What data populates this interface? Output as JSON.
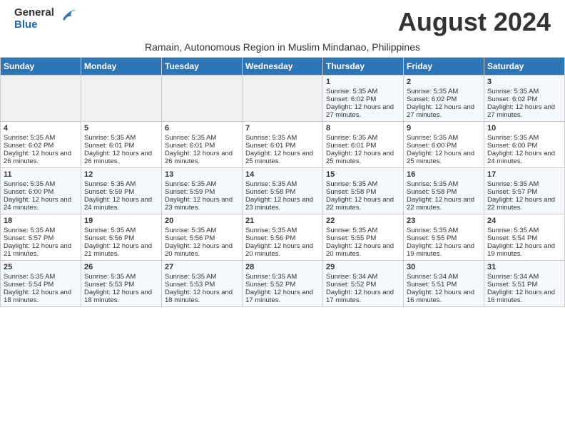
{
  "header": {
    "logo_general": "General",
    "logo_blue": "Blue",
    "month_title": "August 2024",
    "subtitle": "Ramain, Autonomous Region in Muslim Mindanao, Philippines"
  },
  "weekdays": [
    "Sunday",
    "Monday",
    "Tuesday",
    "Wednesday",
    "Thursday",
    "Friday",
    "Saturday"
  ],
  "weeks": [
    [
      {
        "day": "",
        "sunrise": "",
        "sunset": "",
        "daylight": "",
        "empty": true
      },
      {
        "day": "",
        "sunrise": "",
        "sunset": "",
        "daylight": "",
        "empty": true
      },
      {
        "day": "",
        "sunrise": "",
        "sunset": "",
        "daylight": "",
        "empty": true
      },
      {
        "day": "",
        "sunrise": "",
        "sunset": "",
        "daylight": "",
        "empty": true
      },
      {
        "day": "1",
        "sunrise": "Sunrise: 5:35 AM",
        "sunset": "Sunset: 6:02 PM",
        "daylight": "Daylight: 12 hours and 27 minutes."
      },
      {
        "day": "2",
        "sunrise": "Sunrise: 5:35 AM",
        "sunset": "Sunset: 6:02 PM",
        "daylight": "Daylight: 12 hours and 27 minutes."
      },
      {
        "day": "3",
        "sunrise": "Sunrise: 5:35 AM",
        "sunset": "Sunset: 6:02 PM",
        "daylight": "Daylight: 12 hours and 27 minutes."
      }
    ],
    [
      {
        "day": "4",
        "sunrise": "Sunrise: 5:35 AM",
        "sunset": "Sunset: 6:02 PM",
        "daylight": "Daylight: 12 hours and 26 minutes."
      },
      {
        "day": "5",
        "sunrise": "Sunrise: 5:35 AM",
        "sunset": "Sunset: 6:01 PM",
        "daylight": "Daylight: 12 hours and 26 minutes."
      },
      {
        "day": "6",
        "sunrise": "Sunrise: 5:35 AM",
        "sunset": "Sunset: 6:01 PM",
        "daylight": "Daylight: 12 hours and 26 minutes."
      },
      {
        "day": "7",
        "sunrise": "Sunrise: 5:35 AM",
        "sunset": "Sunset: 6:01 PM",
        "daylight": "Daylight: 12 hours and 25 minutes."
      },
      {
        "day": "8",
        "sunrise": "Sunrise: 5:35 AM",
        "sunset": "Sunset: 6:01 PM",
        "daylight": "Daylight: 12 hours and 25 minutes."
      },
      {
        "day": "9",
        "sunrise": "Sunrise: 5:35 AM",
        "sunset": "Sunset: 6:00 PM",
        "daylight": "Daylight: 12 hours and 25 minutes."
      },
      {
        "day": "10",
        "sunrise": "Sunrise: 5:35 AM",
        "sunset": "Sunset: 6:00 PM",
        "daylight": "Daylight: 12 hours and 24 minutes."
      }
    ],
    [
      {
        "day": "11",
        "sunrise": "Sunrise: 5:35 AM",
        "sunset": "Sunset: 6:00 PM",
        "daylight": "Daylight: 12 hours and 24 minutes."
      },
      {
        "day": "12",
        "sunrise": "Sunrise: 5:35 AM",
        "sunset": "Sunset: 5:59 PM",
        "daylight": "Daylight: 12 hours and 24 minutes."
      },
      {
        "day": "13",
        "sunrise": "Sunrise: 5:35 AM",
        "sunset": "Sunset: 5:59 PM",
        "daylight": "Daylight: 12 hours and 23 minutes."
      },
      {
        "day": "14",
        "sunrise": "Sunrise: 5:35 AM",
        "sunset": "Sunset: 5:58 PM",
        "daylight": "Daylight: 12 hours and 23 minutes."
      },
      {
        "day": "15",
        "sunrise": "Sunrise: 5:35 AM",
        "sunset": "Sunset: 5:58 PM",
        "daylight": "Daylight: 12 hours and 22 minutes."
      },
      {
        "day": "16",
        "sunrise": "Sunrise: 5:35 AM",
        "sunset": "Sunset: 5:58 PM",
        "daylight": "Daylight: 12 hours and 22 minutes."
      },
      {
        "day": "17",
        "sunrise": "Sunrise: 5:35 AM",
        "sunset": "Sunset: 5:57 PM",
        "daylight": "Daylight: 12 hours and 22 minutes."
      }
    ],
    [
      {
        "day": "18",
        "sunrise": "Sunrise: 5:35 AM",
        "sunset": "Sunset: 5:57 PM",
        "daylight": "Daylight: 12 hours and 21 minutes."
      },
      {
        "day": "19",
        "sunrise": "Sunrise: 5:35 AM",
        "sunset": "Sunset: 5:56 PM",
        "daylight": "Daylight: 12 hours and 21 minutes."
      },
      {
        "day": "20",
        "sunrise": "Sunrise: 5:35 AM",
        "sunset": "Sunset: 5:56 PM",
        "daylight": "Daylight: 12 hours and 20 minutes."
      },
      {
        "day": "21",
        "sunrise": "Sunrise: 5:35 AM",
        "sunset": "Sunset: 5:56 PM",
        "daylight": "Daylight: 12 hours and 20 minutes."
      },
      {
        "day": "22",
        "sunrise": "Sunrise: 5:35 AM",
        "sunset": "Sunset: 5:55 PM",
        "daylight": "Daylight: 12 hours and 20 minutes."
      },
      {
        "day": "23",
        "sunrise": "Sunrise: 5:35 AM",
        "sunset": "Sunset: 5:55 PM",
        "daylight": "Daylight: 12 hours and 19 minutes."
      },
      {
        "day": "24",
        "sunrise": "Sunrise: 5:35 AM",
        "sunset": "Sunset: 5:54 PM",
        "daylight": "Daylight: 12 hours and 19 minutes."
      }
    ],
    [
      {
        "day": "25",
        "sunrise": "Sunrise: 5:35 AM",
        "sunset": "Sunset: 5:54 PM",
        "daylight": "Daylight: 12 hours and 18 minutes."
      },
      {
        "day": "26",
        "sunrise": "Sunrise: 5:35 AM",
        "sunset": "Sunset: 5:53 PM",
        "daylight": "Daylight: 12 hours and 18 minutes."
      },
      {
        "day": "27",
        "sunrise": "Sunrise: 5:35 AM",
        "sunset": "Sunset: 5:53 PM",
        "daylight": "Daylight: 12 hours and 18 minutes."
      },
      {
        "day": "28",
        "sunrise": "Sunrise: 5:35 AM",
        "sunset": "Sunset: 5:52 PM",
        "daylight": "Daylight: 12 hours and 17 minutes."
      },
      {
        "day": "29",
        "sunrise": "Sunrise: 5:34 AM",
        "sunset": "Sunset: 5:52 PM",
        "daylight": "Daylight: 12 hours and 17 minutes."
      },
      {
        "day": "30",
        "sunrise": "Sunrise: 5:34 AM",
        "sunset": "Sunset: 5:51 PM",
        "daylight": "Daylight: 12 hours and 16 minutes."
      },
      {
        "day": "31",
        "sunrise": "Sunrise: 5:34 AM",
        "sunset": "Sunset: 5:51 PM",
        "daylight": "Daylight: 12 hours and 16 minutes."
      }
    ]
  ]
}
